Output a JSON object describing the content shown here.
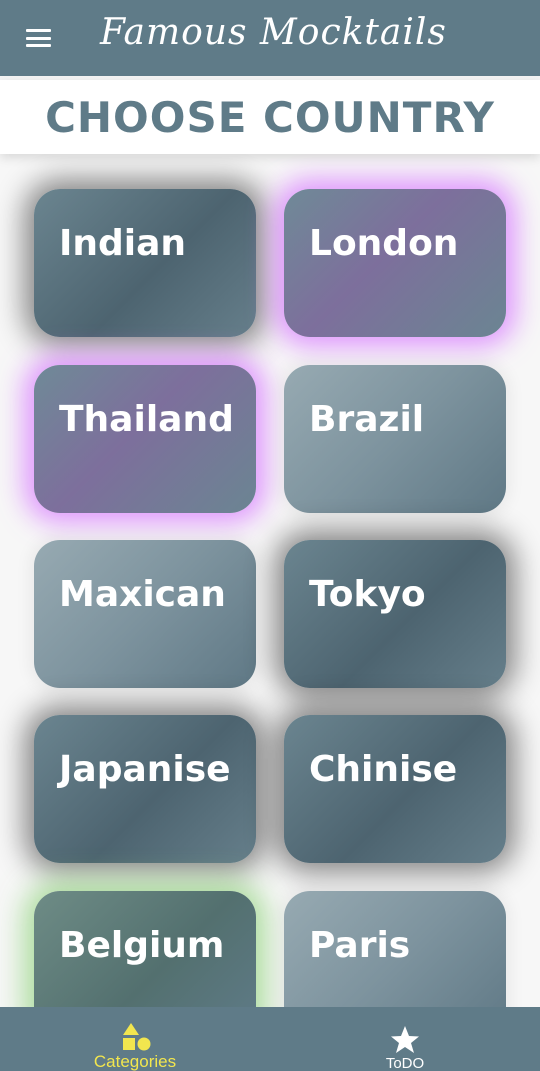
{
  "appbar": {
    "title": "Famous Mocktails",
    "menu_icon": "menu-icon"
  },
  "heading": "CHOOSE COUNTRY",
  "countries": [
    {
      "label": "Indian"
    },
    {
      "label": "London"
    },
    {
      "label": "Thailand"
    },
    {
      "label": "Brazil"
    },
    {
      "label": "Maxican"
    },
    {
      "label": "Tokyo"
    },
    {
      "label": "Japanise"
    },
    {
      "label": "Chinise"
    },
    {
      "label": "Belgium"
    },
    {
      "label": "Paris"
    }
  ],
  "bottom_nav": {
    "items": [
      {
        "label": "Categories",
        "icon": "categories-icon",
        "active": true
      },
      {
        "label": "ToDO",
        "icon": "star-icon",
        "active": false
      }
    ]
  },
  "colors": {
    "primary": "#5f7b88",
    "active_nav": "#f2e64e",
    "glow_purple": "#d778ff",
    "glow_green": "#8cd278"
  }
}
